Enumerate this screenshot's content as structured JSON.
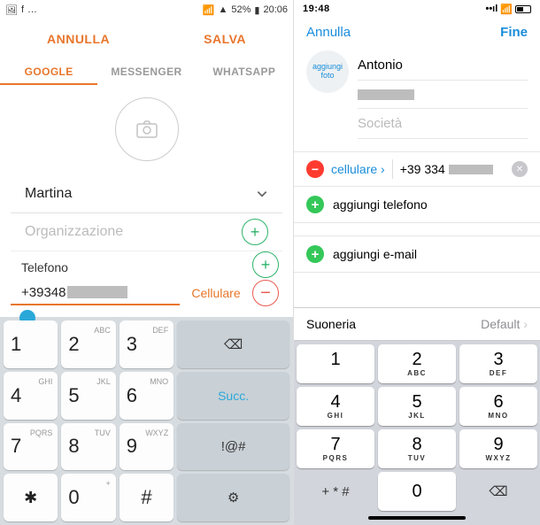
{
  "android": {
    "statusbar": {
      "battery": "52%",
      "time": "20:06"
    },
    "topbar": {
      "cancel": "ANNULLA",
      "save": "SALVA"
    },
    "tabs": {
      "google": "GOOGLE",
      "messenger": "MESSENGER",
      "whatsapp": "WHATSAPP"
    },
    "name": "Martina",
    "org_placeholder": "Organizzazione",
    "phone_section": "Telefono",
    "phone_value": "+39348",
    "phone_type": "Cellulare",
    "keys": {
      "k1": {
        "n": "1",
        "s": ""
      },
      "k2": {
        "n": "2",
        "s": "ABC"
      },
      "k3": {
        "n": "3",
        "s": "DEF"
      },
      "backspace": "⌫",
      "k4": {
        "n": "4",
        "s": "GHI"
      },
      "k5": {
        "n": "5",
        "s": "JKL"
      },
      "k6": {
        "n": "6",
        "s": "MNO"
      },
      "succ": "Succ.",
      "k7": {
        "n": "7",
        "s": "PQRS"
      },
      "k8": {
        "n": "8",
        "s": "TUV"
      },
      "k9": {
        "n": "9",
        "s": "WXYZ"
      },
      "sym": "!@#",
      "star": "✱",
      "k0": {
        "n": "0",
        "s": "+"
      },
      "hash": "#",
      "gear": "⚙"
    }
  },
  "ios": {
    "statusbar": {
      "time": "19:48"
    },
    "nav": {
      "cancel": "Annulla",
      "done": "Fine"
    },
    "addphoto": "aggiungi foto",
    "first_name": "Antonio",
    "company_placeholder": "Società",
    "phone_type": "cellulare",
    "phone_value": "+39 334",
    "add_phone": "aggiungi telefono",
    "add_email": "aggiungi e-mail",
    "ringtone_label": "Suoneria",
    "ringtone_value": "Default",
    "keys": {
      "k1": {
        "n": "1",
        "s": ""
      },
      "k2": {
        "n": "2",
        "s": "ABC"
      },
      "k3": {
        "n": "3",
        "s": "DEF"
      },
      "k4": {
        "n": "4",
        "s": "GHI"
      },
      "k5": {
        "n": "5",
        "s": "JKL"
      },
      "k6": {
        "n": "6",
        "s": "MNO"
      },
      "k7": {
        "n": "7",
        "s": "PQRS"
      },
      "k8": {
        "n": "8",
        "s": "TUV"
      },
      "k9": {
        "n": "9",
        "s": "WXYZ"
      },
      "sym": "+ * #",
      "k0": {
        "n": "0",
        "s": ""
      },
      "backspace": "⌫"
    }
  }
}
